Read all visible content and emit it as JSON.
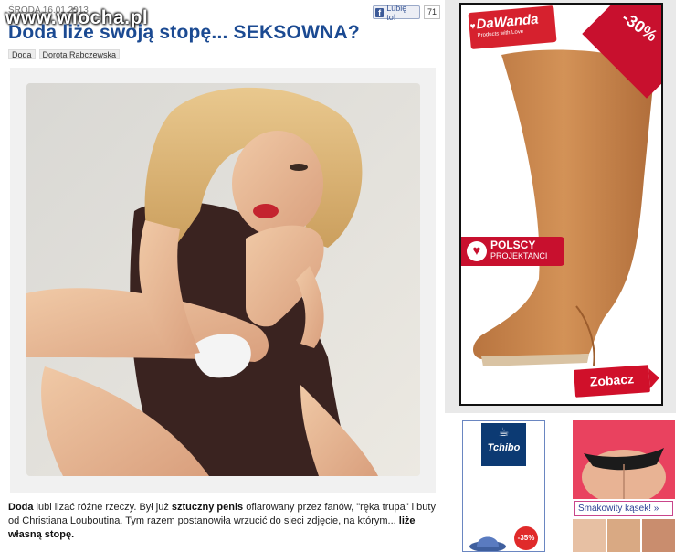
{
  "article": {
    "date": "ŚRODA 16.01.2013",
    "watermark": "www.wiocha.pl",
    "title": "Doda liże swoją stopę... SEKSOWNA?",
    "like_label": "Lubię to!",
    "like_count": "71",
    "tags": [
      "Doda",
      "Dorota Rabczewska"
    ],
    "body": {
      "p1": "Doda",
      "p2": " lubi lizać różne rzeczy. Był już ",
      "p3": "sztuczny penis",
      "p4": " ofiarowany przez fanów, \"ręka trupa\" i buty od Christiana Louboutina. Tym razem postanowiła wrzucić do sieci zdjęcie, na którym... ",
      "p5": "liże własną stopę."
    }
  },
  "ads": {
    "dawanda": {
      "brand": "DaWanda",
      "tagline": "Products with Love",
      "discount": "-30%",
      "badge_line1": "POLSCY",
      "badge_line2": "PROJEKTANCI",
      "cta": "Zobacz"
    },
    "tchibo": {
      "brand": "Tchibo",
      "badge": "-35%"
    },
    "sweets": {
      "link": "Smakowity kąsek! »"
    }
  },
  "colors": {
    "title_blue": "#1b4a92",
    "ad_red": "#c8102e",
    "link_pink": "#c9458b"
  },
  "icons": {
    "facebook": "facebook-icon",
    "heart": "heart-icon",
    "coffee": "coffee-cup-icon"
  }
}
